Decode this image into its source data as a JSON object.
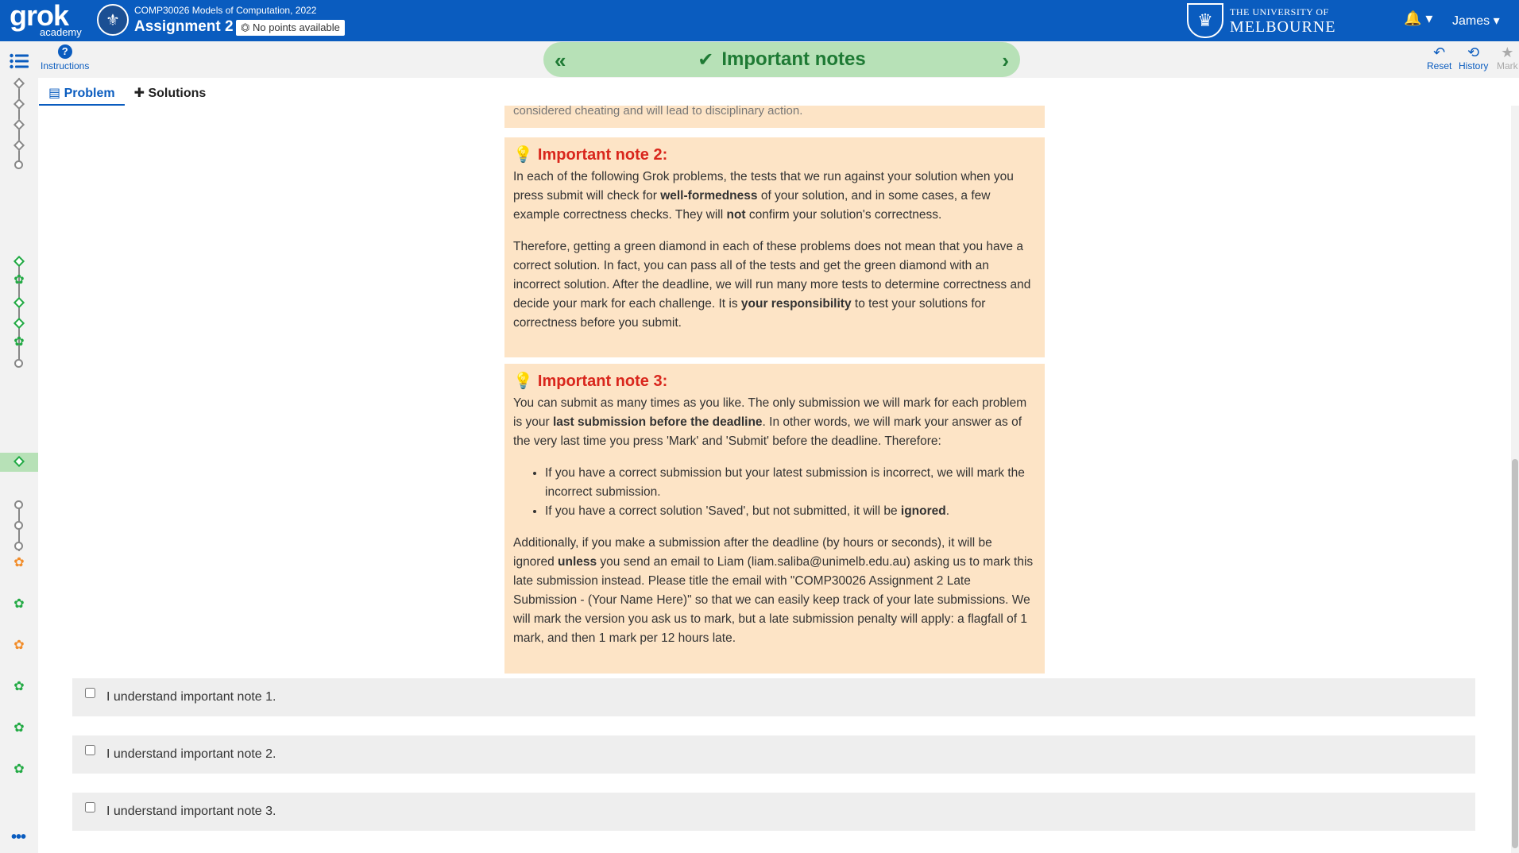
{
  "header": {
    "logo_main": "grok",
    "logo_sub": "academy",
    "course": "COMP30026 Models of Computation, 2022",
    "assignment": "Assignment 2",
    "points_badge": "No points available",
    "university_line1": "THE UNIVERSITY OF",
    "university_line2": "MELBOURNE",
    "user": "James"
  },
  "subbar": {
    "instructions_label": "Instructions",
    "banner_title": "Important notes",
    "reset_label": "Reset",
    "history_label": "History",
    "mark_label": "Mark"
  },
  "tabs": {
    "problem": "Problem",
    "solutions": "Solutions"
  },
  "notes": {
    "partial_text": "considered cheating and will lead to disciplinary action.",
    "note2_title": "Important note 2:",
    "note2_p1_a": "In each of the following Grok problems, the tests that we run against your solution when you press submit will check for ",
    "note2_p1_b": "well-formedness",
    "note2_p1_c": " of your solution, and in some cases, a few example correctness checks. They will ",
    "note2_p1_d": "not",
    "note2_p1_e": " confirm your solution's correctness.",
    "note2_p2_a": "Therefore, getting a green diamond in each of these problems does not mean that you have a correct solution. In fact, you can pass all of the tests and get the green diamond with an incorrect solution. After the deadline, we will run many more tests to determine correctness and decide your mark for each challenge. It is ",
    "note2_p2_b": "your responsibility",
    "note2_p2_c": " to test your solutions for correctness before you submit.",
    "note3_title": "Important note 3:",
    "note3_p1_a": "You can submit as many times as you like. The only submission we will mark for each problem is your ",
    "note3_p1_b": "last submission before the deadline",
    "note3_p1_c": ". In other words, we will mark your answer as of the very last time you press 'Mark' and 'Submit' before the deadline. Therefore:",
    "note3_li1": "If you have a correct submission but your latest submission is incorrect, we will mark the incorrect submission.",
    "note3_li2_a": "If you have a correct solution 'Saved', but not submitted, it will be ",
    "note3_li2_b": "ignored",
    "note3_li2_c": ".",
    "note3_p2_a": "Additionally, if you make a submission after the deadline (by hours or seconds), it will be ignored ",
    "note3_p2_b": "unless",
    "note3_p2_c": " you send an email to Liam (liam.saliba@unimelb.edu.au) asking us to mark this late submission instead. Please title the email with \"COMP30026 Assignment 2 Late Submission - (Your Name Here)\" so that we can easily keep track of your late submissions. We will mark the version you ask us to mark, but a late submission penalty will apply: a flagfall of 1 mark, and then 1 mark per 12 hours late."
  },
  "checkboxes": [
    {
      "label": "I understand important note 1.",
      "checked": false
    },
    {
      "label": "I understand important note 2.",
      "checked": false
    },
    {
      "label": "I understand important note 3.",
      "checked": false
    }
  ],
  "colors": {
    "brand_blue": "#0a5cbf",
    "banner_green": "#b7e1b7",
    "note_bg": "#fde4c6",
    "note_title": "#d9261c"
  }
}
